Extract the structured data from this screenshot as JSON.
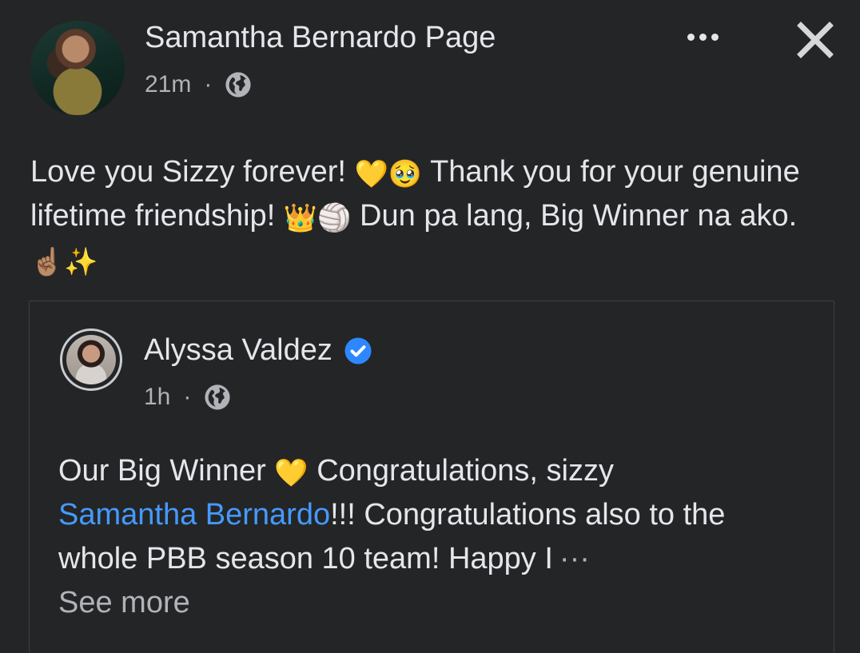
{
  "post": {
    "author": "Samantha Bernardo Page",
    "time": "21m",
    "separator": "·",
    "privacy_icon": "globe-icon",
    "text_segments": {
      "s1": "Love you Sizzy forever! ",
      "e1": "💛",
      "e2": "🥹",
      "s2": " Thank you for your genuine lifetime friendship! ",
      "e3": "👑",
      "e4": "🏐",
      "s3": " Dun pa lang, Big Winner na ako. ",
      "e5": "☝🏽",
      "e6": "✨"
    }
  },
  "toolbar": {
    "more_icon": "more-options-icon",
    "close_icon": "close-icon"
  },
  "shared_post": {
    "author": "Alyssa Valdez",
    "verified_icon": "verified-badge-icon",
    "time": "1h",
    "separator": "·",
    "privacy_icon": "globe-icon",
    "text_segments": {
      "s1": "Our Big Winner ",
      "e1": "💛",
      "s2": " Congratulations, sizzy ",
      "mention": "Samantha Bernardo",
      "s3": "!!! Congratulations also to the whole PBB season 10 team! Happy I",
      "ellipsis": "···",
      "see_more": "See more"
    }
  },
  "colors": {
    "background": "#242526",
    "text": "#e4e6eb",
    "secondary_text": "#b0b3b8",
    "link": "#4599ff",
    "verified": "#2d88ff"
  }
}
